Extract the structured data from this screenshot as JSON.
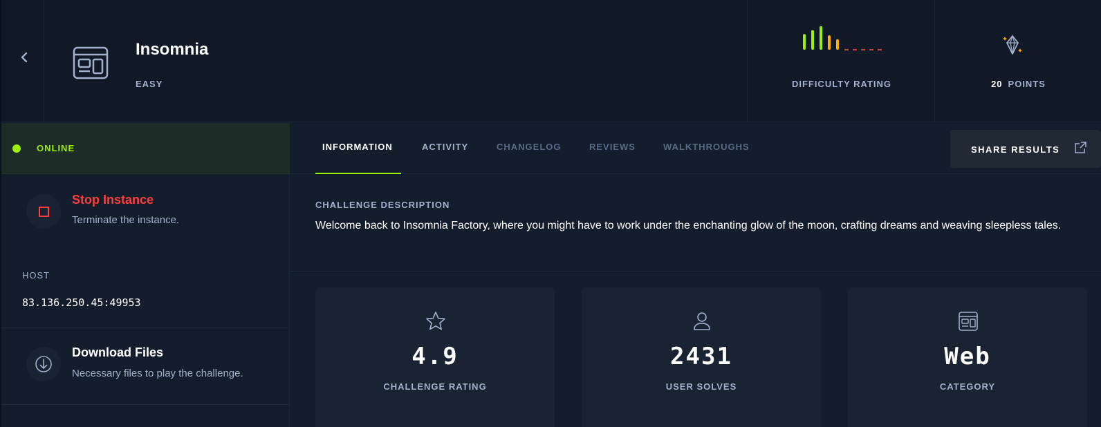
{
  "header": {
    "title": "Insomnia",
    "difficulty": "EASY",
    "difficulty_rating_label": "DIFFICULTY RATING",
    "points_value": "20",
    "points_label": "POINTS",
    "difficulty_bars": [
      0.6,
      0.75,
      0.9,
      0.55,
      0.4,
      0.08,
      0.08,
      0.08,
      0.08,
      0.08
    ]
  },
  "sidebar": {
    "status": "ONLINE",
    "stop": {
      "title": "Stop Instance",
      "subtitle": "Terminate the instance."
    },
    "host_label": "HOST",
    "host_value": "83.136.250.45:49953",
    "download": {
      "title": "Download Files",
      "subtitle": "Necessary files to play the challenge."
    }
  },
  "tabs": [
    {
      "label": "INFORMATION",
      "active": true
    },
    {
      "label": "ACTIVITY"
    },
    {
      "label": "CHANGELOG"
    },
    {
      "label": "REVIEWS"
    },
    {
      "label": "WALKTHROUGHS"
    }
  ],
  "share_label": "SHARE RESULTS",
  "description": {
    "label": "CHALLENGE DESCRIPTION",
    "text": "Welcome back to Insomnia Factory, where you might have to work under the enchanting glow of the moon, crafting dreams and weaving sleepless tales."
  },
  "stats": [
    {
      "value": "4.9",
      "label": "CHALLENGE RATING",
      "icon": "star-icon"
    },
    {
      "value": "2431",
      "label": "USER SOLVES",
      "icon": "user-icon"
    },
    {
      "value": "Web",
      "label": "CATEGORY",
      "icon": "web-category-icon"
    }
  ],
  "colors": {
    "accent": "#9fef00",
    "danger": "#ff3e3e",
    "orange": "#ffaf00",
    "background": "#141d2b",
    "card": "#1a2332"
  }
}
